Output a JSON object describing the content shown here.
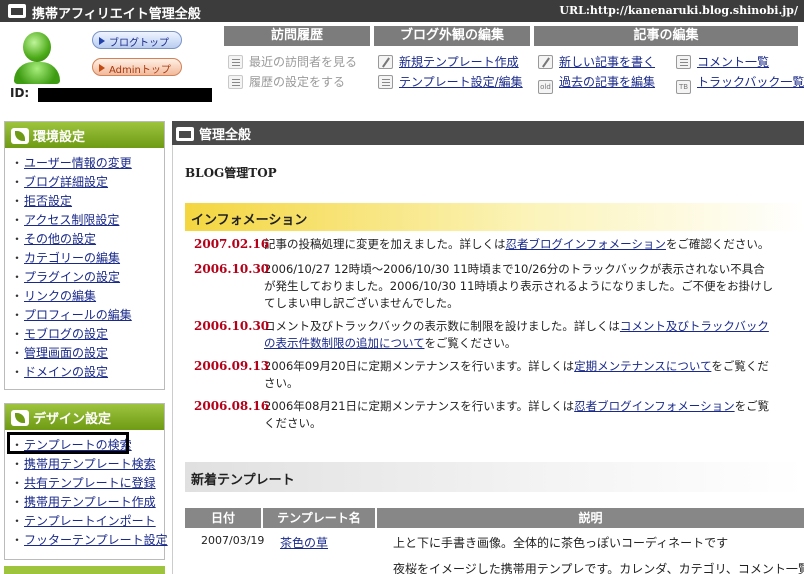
{
  "topbar": {
    "title": "携帯アフィリエイト管理全般",
    "url": "URL:http://kanenaruki.blog.shinobi.jp/"
  },
  "header": {
    "blog_top_btn": "ブログトップ",
    "admin_top_btn": "Adminトップ",
    "id_label": "ID:",
    "visit_history": {
      "title": "訪問履歴",
      "items": [
        "最近の訪問者を見る",
        "履歴の設定をする"
      ]
    },
    "blog_appearance": {
      "title": "ブログ外観の編集",
      "items": [
        "新規テンプレート作成",
        "テンプレート設定/編集"
      ]
    },
    "article_edit": {
      "title": "記事の編集",
      "items": [
        "新しい記事を書く",
        "過去の記事を編集",
        "コメント一覧",
        "トラックバック一覧"
      ],
      "icon_labels": [
        "old",
        "TB"
      ]
    }
  },
  "sidebar": {
    "env": {
      "title": "環境設定",
      "items": [
        "ユーザー情報の変更",
        "ブログ詳細設定",
        "拒否設定",
        "アクセス制限設定",
        "その他の設定",
        "カテゴリーの編集",
        "プラグインの設定",
        "リンクの編集",
        "プロフィールの編集",
        "モブログの設定",
        "管理画面の設定",
        "ドメインの設定"
      ]
    },
    "design": {
      "title": "デザイン設定",
      "items": [
        "テンプレートの検索",
        "携帯用テンプレート検索",
        "共有テンプレートに登録",
        "携帯用テンプレート作成",
        "テンプレートインポート",
        "フッターテンプレート設定"
      ]
    }
  },
  "main": {
    "header": "管理全般",
    "blog_top": "BLOG管理TOP",
    "info_title": "インフォメーション",
    "news": [
      {
        "date": "2007.02.16",
        "pre": "記事の投稿処理に変更を加えました。詳しくは",
        "link": "忍者ブログインフォメーション",
        "post": "をご確認ください。"
      },
      {
        "date": "2006.10.30",
        "pre": "2006/10/27 12時頃～2006/10/30 11時頃まで10/26分のトラックバックが表示されない不具合が発生しておりました。2006/10/30 11時頃より表示されるようになりました。ご不便をお掛けしてしまい申し訳ございませんでした。",
        "link": "",
        "post": ""
      },
      {
        "date": "2006.10.30",
        "pre": "コメント及びトラックバックの表示数に制限を設けました。詳しくは",
        "link": "コメント及びトラックバックの表示件数制限の追加について",
        "post": "をご覧ください。"
      },
      {
        "date": "2006.09.13",
        "pre": "2006年09月20日に定期メンテナンスを行います。詳しくは",
        "link": "定期メンテナンスについて",
        "post": "をご覧ください。"
      },
      {
        "date": "2006.08.16",
        "pre": "2006年08月21日に定期メンテナンスを行います。詳しくは",
        "link": "忍者ブログインフォメーション",
        "post": "をご覧ください。"
      }
    ],
    "new_templates_title": "新着テンプレート",
    "table": {
      "headers": [
        "日付",
        "テンプレート名",
        "説明"
      ],
      "rows": [
        {
          "date": "2007/03/19",
          "name": "茶色の草",
          "desc": "上と下に手書き画像。全体的に茶色っぽいコーディネートです"
        },
        {
          "date": "",
          "name": "",
          "desc": "夜桜をイメージした携帯用テンプレです。カレンダ、カテゴリ、コメント一覧"
        }
      ]
    }
  }
}
